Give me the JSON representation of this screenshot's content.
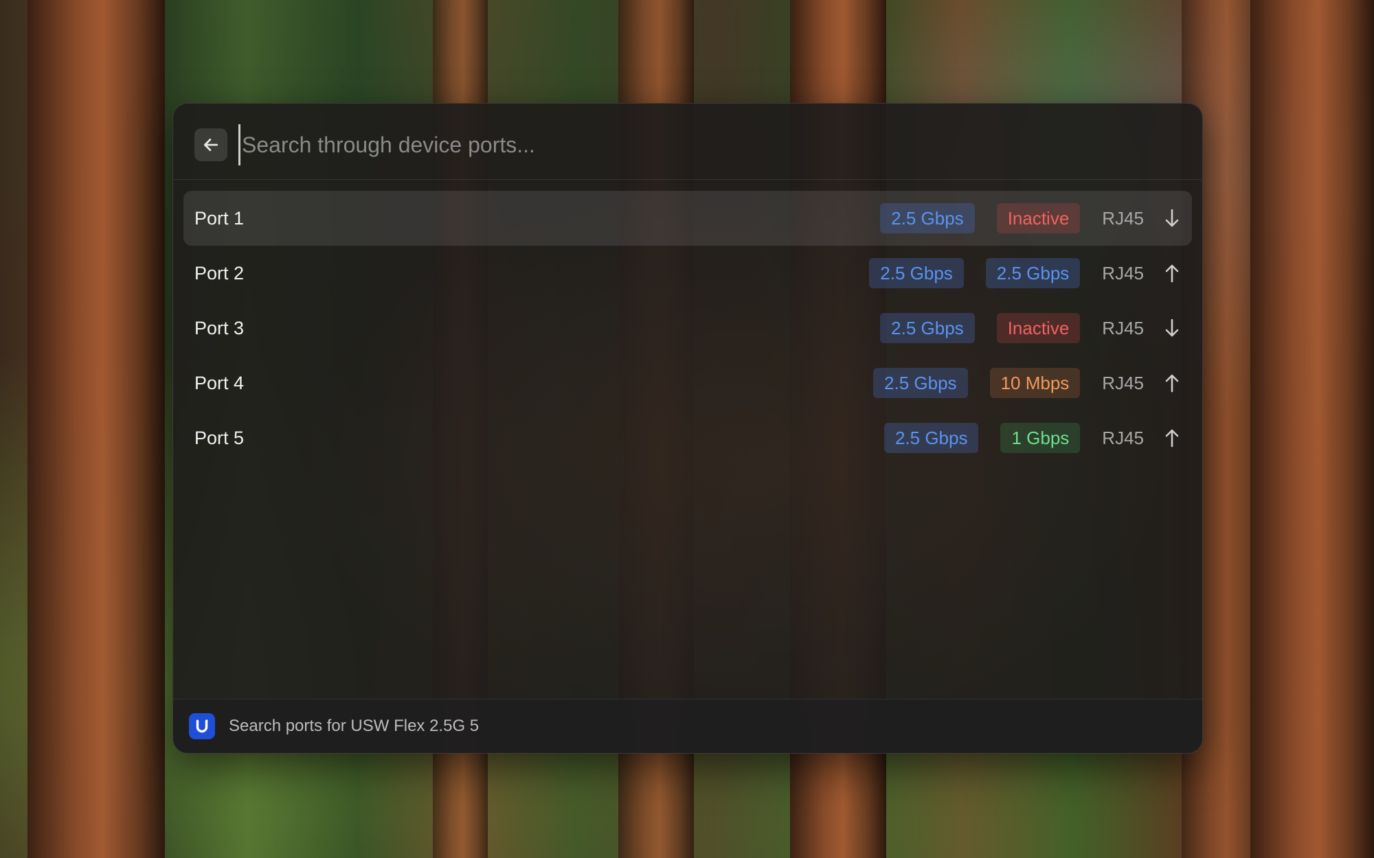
{
  "search": {
    "placeholder": "Search through device ports...",
    "value": ""
  },
  "ports": [
    {
      "name": "Port 1",
      "capability": "2.5 Gbps",
      "status": "Inactive",
      "status_color": "red",
      "type": "RJ45",
      "direction": "down",
      "selected": true
    },
    {
      "name": "Port 2",
      "capability": "2.5 Gbps",
      "status": "2.5 Gbps",
      "status_color": "blue",
      "type": "RJ45",
      "direction": "up",
      "selected": false
    },
    {
      "name": "Port 3",
      "capability": "2.5 Gbps",
      "status": "Inactive",
      "status_color": "red",
      "type": "RJ45",
      "direction": "down",
      "selected": false
    },
    {
      "name": "Port 4",
      "capability": "2.5 Gbps",
      "status": "10 Mbps",
      "status_color": "orange",
      "type": "RJ45",
      "direction": "up",
      "selected": false
    },
    {
      "name": "Port 5",
      "capability": "2.5 Gbps",
      "status": "1 Gbps",
      "status_color": "green",
      "type": "RJ45",
      "direction": "up",
      "selected": false
    }
  ],
  "footer": {
    "title": "Search ports for USW Flex 2.5G 5",
    "logo_icon": "ubiquiti-logo-icon"
  },
  "colors": {
    "blue_tag": "#5b93f0",
    "red_tag": "#f06262",
    "orange_tag": "#f29a5c",
    "green_tag": "#6fe08f",
    "logo_bg": "#1f4fd6"
  }
}
